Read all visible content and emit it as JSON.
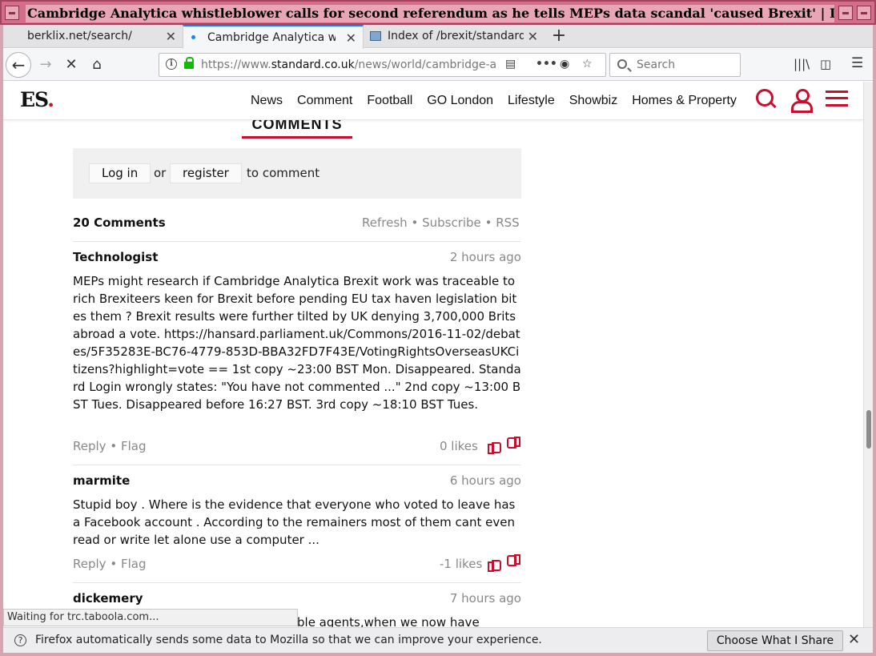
{
  "window": {
    "title": "Cambridge Analytica whistleblower calls for second referendum as he tells MEPs data scandal 'caused Brexit' | London Evening Standard"
  },
  "tabs": [
    {
      "label": "berklix.net/search/",
      "active": false
    },
    {
      "label": "Cambridge Analytica whistleblower",
      "active": true
    },
    {
      "label": "Index of /brexit/standard",
      "active": false
    }
  ],
  "navbar": {
    "url_prefix": "https://www.",
    "url_domain": "standard.co.uk",
    "url_path": "/news/world/cambridge-analytica-whistleblower",
    "search_placeholder": "Search"
  },
  "site": {
    "logo_text": "ES",
    "logo_dot": ".",
    "accent_color": "#c8102e",
    "nav": [
      "News",
      "Comment",
      "Football",
      "GO London",
      "Lifestyle",
      "Showbiz",
      "Homes & Property"
    ]
  },
  "comments_section": {
    "title": "COMMENTS",
    "login_label": "Log in",
    "or_text": "or",
    "register_label": "register",
    "to_comment_text": "to comment",
    "count_text": "20 Comments",
    "refresh": "Refresh",
    "subscribe": "Subscribe",
    "rss": "RSS",
    "sep": "•"
  },
  "comments": [
    {
      "author": "Technologist",
      "time": "2 hours ago",
      "body": "MEPs might research if Cambridge Analytica Brexit work was traceable to rich Brexiteers keen for Brexit before pending EU tax haven legislation bites them ? Brexit results were further tilted by UK denying 3,700,000 Brits abroad a vote. https://hansard.parliament.uk/Commons/2016-11-02/debates/5F35283E-BC76-4779-853D-BBA32FD7F43E/VotingRightsOverseasUKCitizens?highlight=vote == 1st copy ~23:00 BST Mon. Disappeared. Standard Login wrongly states: \"You have not commented ...\" 2nd copy ~13:00 BST Tues. Disappeared before 16:27 BST. 3rd copy ~18:10 BST Tues.",
      "reply": "Reply",
      "flag": "Flag",
      "likes": "0 likes"
    },
    {
      "author": "marmite",
      "time": "6 hours ago",
      "body": "Stupid boy . Where is the evidence that everyone who voted to leave has a Facebook account . According to the remainers most of them cant even read or write let alone use a computer ...",
      "reply": "Reply",
      "flag": "Flag",
      "likes": "-1 likes"
    },
    {
      "author": "dickemery",
      "time": "7 hours ago",
      "body": "ble agents,when we now have"
    }
  ],
  "status_text": "Waiting for trc.taboola.com...",
  "notification": {
    "text": "Firefox automatically sends some data to Mozilla so that we can improve your experience.",
    "button": "Choose What I Share"
  }
}
